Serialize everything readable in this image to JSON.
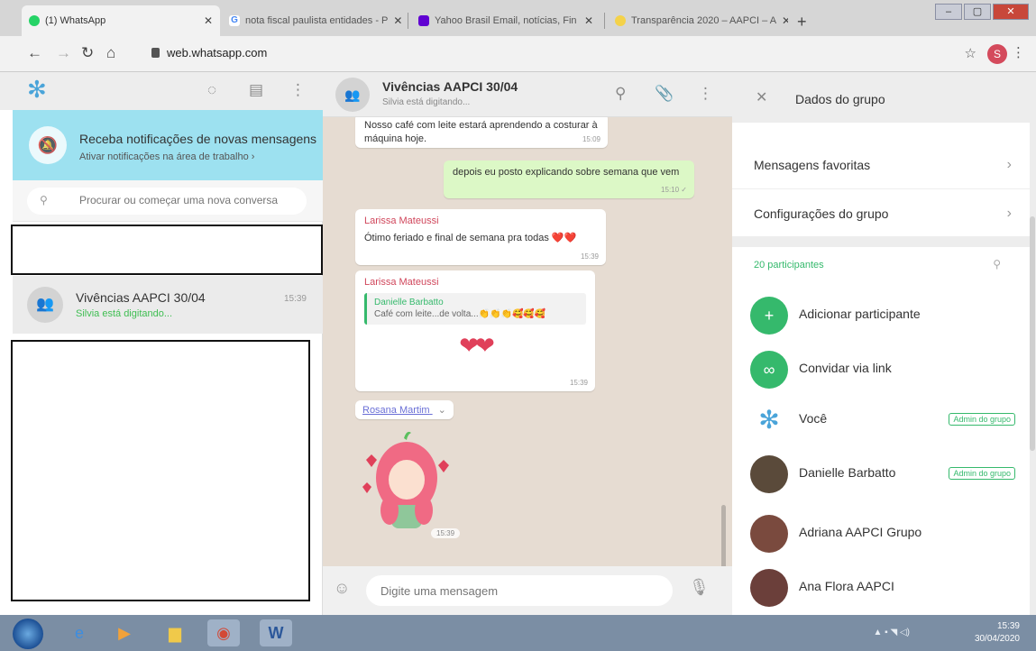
{
  "browser": {
    "tabs": [
      {
        "label": "(1) WhatsApp",
        "color": "#25d366"
      },
      {
        "label": "nota fiscal paulista entidades - P",
        "color": "#4285f4"
      },
      {
        "label": "Yahoo Brasil Email, notícias, Fin",
        "color": "#6001d2"
      },
      {
        "label": "Transparência 2020 – AAPCI – A",
        "color": "#4aa4d9"
      }
    ],
    "url": "web.whatsapp.com",
    "profile_letter": "S"
  },
  "left": {
    "notification": {
      "title": "Receba notificações de novas mensagens",
      "subtitle": "Ativar notificações na área de trabalho ›"
    },
    "search_placeholder": "Procurar ou começar uma nova conversa",
    "chat": {
      "name": "Vivências AAPCI 30/04",
      "time": "15:39",
      "status": "Silvia está digitando..."
    }
  },
  "conversation": {
    "name": "Vivências AAPCI 30/04",
    "status": "Silvia está digitando...",
    "messages": {
      "m1_text": "Nosso café com leite estará aprendendo a costurar à máquina hoje.",
      "m1_time": "15:09",
      "m2_text": "depois eu posto explicando sobre semana que vem",
      "m2_time": "15:10 ✓",
      "m3_sender": "Larissa Mateussi",
      "m3_text": "Ótimo feriado e final de semana pra todas ❤️❤️",
      "m3_time": "15:39",
      "m4_sender": "Larissa Mateussi",
      "m4_quote_name": "Danielle Barbatto",
      "m4_quote_text": "Café com leite...de volta...👏👏👏🥰🥰🥰",
      "m4_hearts": "❤❤",
      "m4_time": "15:39",
      "m5_sender": "Rosana Martim",
      "m5_time": "15:39"
    },
    "composer_placeholder": "Digite uma mensagem"
  },
  "group_info": {
    "title": "Dados do grupo",
    "rows": {
      "favorites": "Mensagens favoritas",
      "settings": "Configurações do grupo"
    },
    "participants_count": "20 participantes",
    "actions": {
      "add": "Adicionar participante",
      "invite": "Convidar via link"
    },
    "participants": [
      {
        "name": "Você",
        "badge": "Admin do grupo"
      },
      {
        "name": "Danielle Barbatto",
        "badge": "Admin do grupo"
      },
      {
        "name": "Adriana AAPCI Grupo",
        "badge": ""
      },
      {
        "name": "Ana Flora AAPCI",
        "badge": ""
      }
    ]
  },
  "taskbar": {
    "time": "15:39",
    "date": "30/04/2020"
  },
  "colors": {
    "accent_green": "#35b96c",
    "notification_banner": "#9de1f0",
    "outgoing_bubble": "#dcf8c6",
    "sender_name": "#d0465b"
  }
}
